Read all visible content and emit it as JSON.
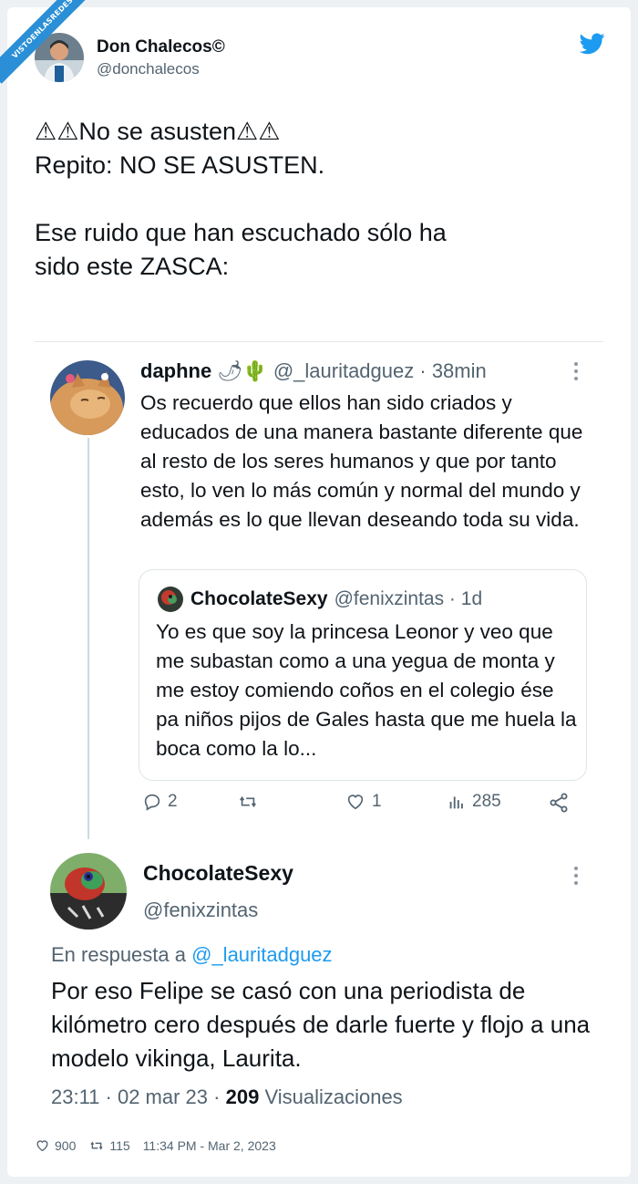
{
  "watermark": "VISTOENLASREDES",
  "author": {
    "name": "Don Chalecos©",
    "handle": "@donchalecos"
  },
  "tweet": {
    "text": "⚠⚠No se asusten⚠⚠\nRepito: NO SE ASUSTEN.\n\nEse ruido que han escuchado sólo ha\nsido este ZASCA:"
  },
  "embedded": {
    "quoted_tweet": {
      "name": "daphne",
      "emoji": "🌶🌵",
      "handle": "@_lauritadguez",
      "time": "· 38min",
      "text": "Os recuerdo que ellos han sido criados y educados de una manera bastante diferente que al resto de los seres humanos y que por tanto esto, lo ven lo más común y normal del mundo y además es lo que llevan deseando toda su vida.",
      "inner_quote": {
        "name": "ChocolateSexy",
        "handle": "@fenixzintas · 1d",
        "text": "Yo es que soy la princesa Leonor y veo que me subastan como a una yegua de monta y me estoy comiendo coños en el colegio ése pa niños pijos de Gales hasta que me huela la boca como la lo..."
      },
      "actions": {
        "replies": "2",
        "retweets": "",
        "likes": "1",
        "views": "285"
      }
    },
    "reply": {
      "name": "ChocolateSexy",
      "handle": "@fenixzintas",
      "reply_prefix": "En respuesta a",
      "reply_to": "@_lauritadguez",
      "text": "Por eso Felipe se casó con una periodista de kilómetro cero después de darle fuerte y flojo a una modelo vikinga, Laurita.",
      "timestamp": "23:11 · 02 mar 23 ·",
      "views_count": "209",
      "views_label": "Visualizaciones"
    }
  },
  "footer": {
    "likes": "900",
    "retweets": "115",
    "datetime": "11:34 PM - Mar 2, 2023"
  },
  "colors": {
    "twitter_blue": "#1d9bf0",
    "muted": "#536471",
    "text": "#0f1419",
    "watermark_blue": "#2a8fd6"
  }
}
